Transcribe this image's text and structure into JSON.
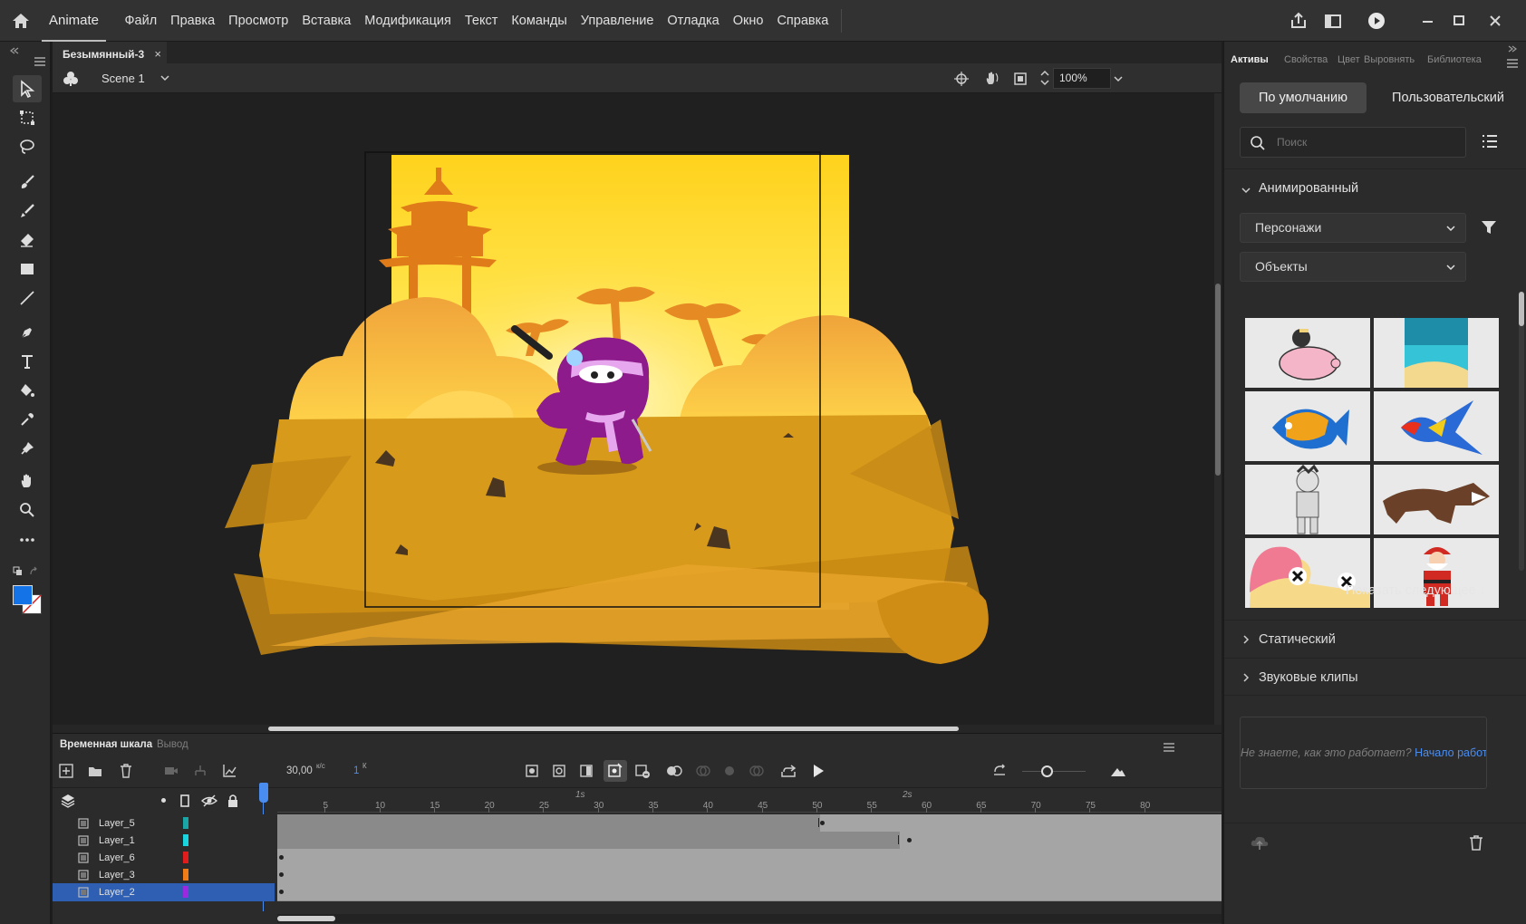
{
  "app": {
    "name": "Animate"
  },
  "menu": [
    "Файл",
    "Правка",
    "Просмотр",
    "Вставка",
    "Модификация",
    "Текст",
    "Команды",
    "Управление",
    "Отладка",
    "Окно",
    "Справка"
  ],
  "document": {
    "tab_title": "Безымянный-3",
    "close": "×",
    "scene": "Scene 1",
    "zoom": "100%"
  },
  "timeline": {
    "tab_active": "Временная шкала",
    "tab_output": "Вывод",
    "fps_value": "30,00",
    "fps_unit": "к/с",
    "current_frame": "1",
    "frame_unit": "К",
    "second_markers": [
      "1s",
      "2s"
    ],
    "ruler": [
      "5",
      "10",
      "15",
      "20",
      "25",
      "30",
      "35",
      "40",
      "45",
      "50",
      "55",
      "60",
      "65",
      "70",
      "75",
      "80"
    ],
    "layers": [
      {
        "name": "Layer_5",
        "color": "#1aa6a6",
        "selected": false
      },
      {
        "name": "Layer_1",
        "color": "#19d5e0",
        "selected": false
      },
      {
        "name": "Layer_6",
        "color": "#e01c1c",
        "selected": false
      },
      {
        "name": "Layer_3",
        "color": "#f07c18",
        "selected": false
      },
      {
        "name": "Layer_2",
        "color": "#9a2ae0",
        "selected": true
      }
    ]
  },
  "right_panel": {
    "tabs": [
      "Активы",
      "Свойства",
      "Цвет",
      "Выровнять",
      "Библиотека"
    ],
    "active_tab": "Активы",
    "toggle_default": "По умолчанию",
    "toggle_custom": "Пользовательский",
    "search_placeholder": "Поиск",
    "section_animated": "Анимированный",
    "dropdown_category": "Персонажи",
    "dropdown_type": "Объекты",
    "show_more": "Показать следующее ↓",
    "section_static": "Статический",
    "section_sound": "Звуковые клипы",
    "help_text": "Не знаете, как это работает?",
    "help_link": "Начало работы"
  },
  "colors": {
    "stroke": "#000000",
    "fill": "#1473e6",
    "accent": "#2f6fdc",
    "sky_top": "#ffd21c",
    "ground": "#d79a1a",
    "ninja": "#8e1b8c"
  }
}
